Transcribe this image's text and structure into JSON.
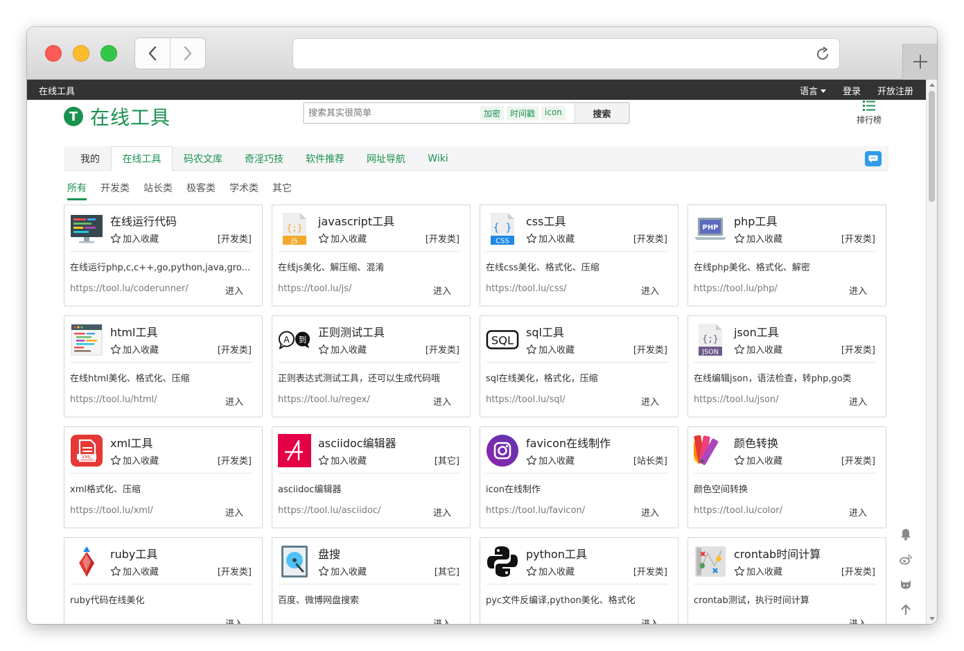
{
  "topbar": {
    "site_name": "在线工具",
    "language": "语言",
    "login": "登录",
    "register": "开放注册"
  },
  "header": {
    "logo_letter": "T",
    "logo_text": "在线工具",
    "search_placeholder": "搜索其实很简单",
    "search_tags": [
      "加密",
      "时间戳",
      "icon"
    ],
    "search_button": "搜索",
    "ranking": "排行榜"
  },
  "tabs": [
    {
      "label": "我的"
    },
    {
      "label": "在线工具",
      "active": true
    },
    {
      "label": "码农文库"
    },
    {
      "label": "奇淫巧技"
    },
    {
      "label": "软件推荐"
    },
    {
      "label": "网址导航"
    },
    {
      "label": "Wiki"
    }
  ],
  "categories": [
    {
      "label": "所有",
      "active": true
    },
    {
      "label": "开发类"
    },
    {
      "label": "站长类"
    },
    {
      "label": "极客类"
    },
    {
      "label": "学术类"
    },
    {
      "label": "其它"
    }
  ],
  "card_common": {
    "favorite": "加入收藏",
    "enter": "进入"
  },
  "cards": [
    {
      "icon": "monitor-code-icon",
      "title": "在线运行代码",
      "category": "[开发类]",
      "desc": "在线运行php,c,c++,go,python,java,gro...",
      "url": "https://tool.lu/coderunner/"
    },
    {
      "icon": "js-file-icon",
      "title": "javascript工具",
      "category": "[开发类]",
      "desc": "在线js美化、解压缩、混淆",
      "url": "https://tool.lu/js/"
    },
    {
      "icon": "css-file-icon",
      "title": "css工具",
      "category": "[开发类]",
      "desc": "在线css美化、格式化、压缩",
      "url": "https://tool.lu/css/"
    },
    {
      "icon": "php-laptop-icon",
      "title": "php工具",
      "category": "[开发类]",
      "desc": "在线php美化、格式化、解密",
      "url": "https://tool.lu/php/"
    },
    {
      "icon": "html-code-icon",
      "title": "html工具",
      "category": "[开发类]",
      "desc": "在线html美化、格式化、压缩",
      "url": "https://tool.lu/html/"
    },
    {
      "icon": "regex-bubbles-icon",
      "title": "正则测试工具",
      "category": "[开发类]",
      "desc": "正则表达式测试工具，还可以生成代码哦",
      "url": "https://tool.lu/regex/"
    },
    {
      "icon": "sql-icon",
      "title": "sql工具",
      "category": "[开发类]",
      "desc": "sql在线美化，格式化，压缩",
      "url": "https://tool.lu/sql/"
    },
    {
      "icon": "json-file-icon",
      "title": "json工具",
      "category": "[开发类]",
      "desc": "在线编辑json，语法检查，转php,go类",
      "url": "https://tool.lu/json/"
    },
    {
      "icon": "xml-file-icon",
      "title": "xml工具",
      "category": "[开发类]",
      "desc": "xml格式化、压缩",
      "url": "https://tool.lu/xml/"
    },
    {
      "icon": "asciidoc-icon",
      "title": "asciidoc编辑器",
      "category": "[其它]",
      "desc": "asciidoc编辑器",
      "url": "https://tool.lu/asciidoc/"
    },
    {
      "icon": "favicon-camera-icon",
      "title": "favicon在线制作",
      "category": "[站长类]",
      "desc": "icon在线制作",
      "url": "https://tool.lu/favicon/"
    },
    {
      "icon": "color-fan-icon",
      "title": "颜色转换",
      "category": "[开发类]",
      "desc": "颜色空间转换",
      "url": "https://tool.lu/color/"
    },
    {
      "icon": "ruby-gem-icon",
      "title": "ruby工具",
      "category": "[开发类]",
      "desc": "ruby代码在线美化",
      "url": ""
    },
    {
      "icon": "disk-search-icon",
      "title": "盘搜",
      "category": "[其它]",
      "desc": "百度、微博网盘搜索",
      "url": ""
    },
    {
      "icon": "python-logo-icon",
      "title": "python工具",
      "category": "[开发类]",
      "desc": "pyc文件反编译,python美化、格式化",
      "url": ""
    },
    {
      "icon": "crontab-icon",
      "title": "crontab时间计算",
      "category": "[开发类]",
      "desc": "crontab测试，执行时间计算",
      "url": ""
    }
  ],
  "side_tools": [
    "bell-icon",
    "weibo-icon",
    "github-icon",
    "back-to-top-icon"
  ],
  "colors": {
    "brand_green": "#1a9150",
    "topbar_bg": "#333333",
    "chat_blue": "#2f9bea"
  }
}
